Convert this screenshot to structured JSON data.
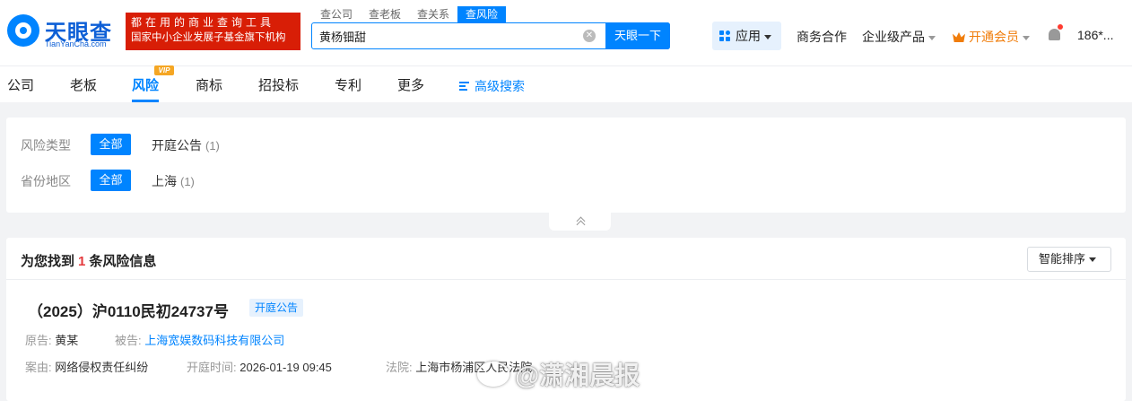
{
  "header": {
    "logo_name": "天眼查",
    "logo_domain": "TianYanCha.com",
    "slogan_line1": "都在用的商业查询工具",
    "slogan_line2": "国家中小企业发展子基金旗下机构",
    "search_tabs": [
      "查公司",
      "查老板",
      "查关系",
      "查风险"
    ],
    "search_value": "黄杨钿甜",
    "search_button": "天眼一下",
    "apps_label": "应用",
    "business_link": "商务合作",
    "enterprise_link": "企业级产品",
    "vip_link": "开通会员",
    "user_label": "186*..."
  },
  "nav": {
    "items": [
      "公司",
      "老板",
      "风险",
      "商标",
      "招投标",
      "专利",
      "更多"
    ],
    "vip_badge": "VIP",
    "advanced_search": "高级搜索"
  },
  "filters": {
    "risk_type_label": "风险类型",
    "region_label": "省份地区",
    "all_label": "全部",
    "risk_type_option": "开庭公告",
    "risk_type_count": "(1)",
    "region_option": "上海",
    "region_count": "(1)"
  },
  "results": {
    "title_prefix": "为您找到",
    "count": "1",
    "title_suffix": "条风险信息",
    "sort_label": "智能排序",
    "case": {
      "title": "（2025）沪0110民初24737号",
      "badge": "开庭公告",
      "plaintiff_label": "原告:",
      "plaintiff": "黄某",
      "defendant_label": "被告:",
      "defendant": "上海宽娱数码科技有限公司",
      "cause_label": "案由:",
      "cause": "网络侵权责任纠纷",
      "hearing_label": "开庭时间:",
      "hearing_time": "2026-01-19 09:45",
      "court_label": "法院:",
      "court": "上海市杨浦区人民法院"
    }
  },
  "watermark": {
    "text": "@潇湘晨报"
  },
  "colors": {
    "brand_blue": "#0084ff",
    "slogan_red": "#d81e06",
    "vip_orange": "#f07d0b",
    "count_red": "#e4393c"
  }
}
